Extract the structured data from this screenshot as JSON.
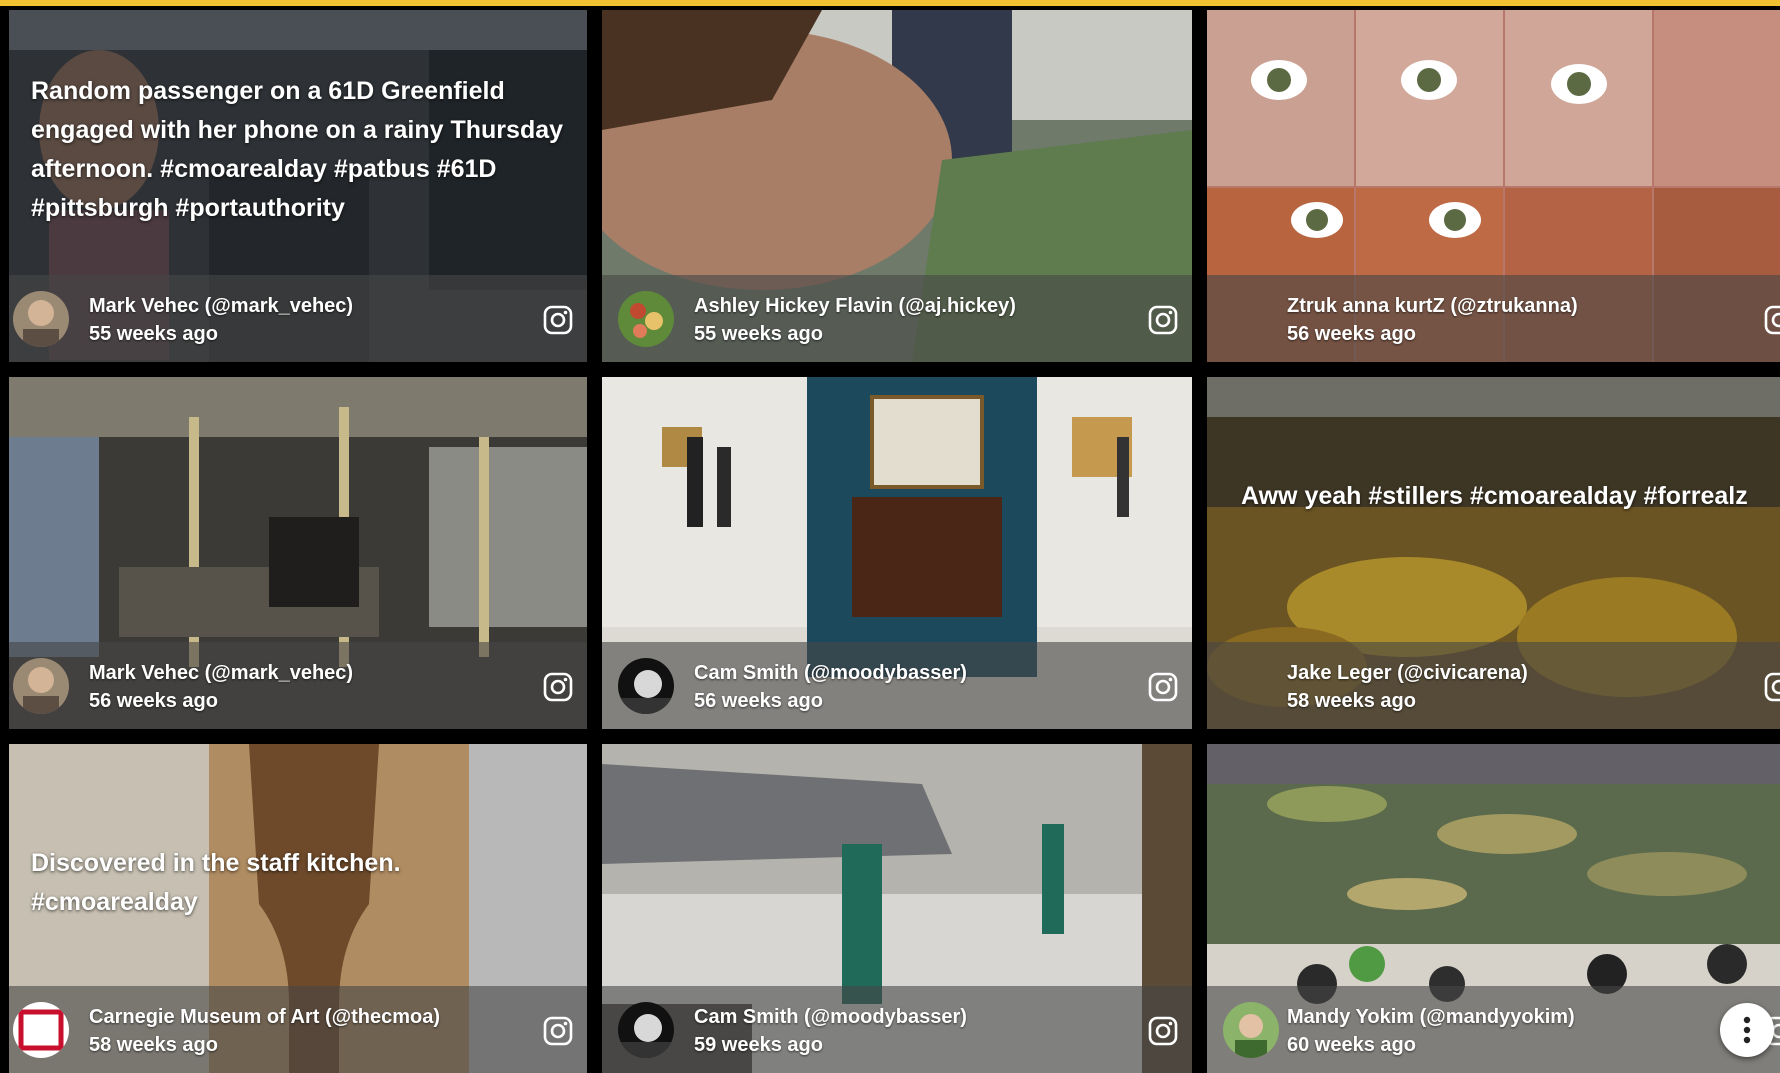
{
  "feed": {
    "tiles": [
      {
        "caption": "Random passenger on a 61D Greenfield engaged with her phone on a rainy Thursday afternoon. #cmoarealday #patbus #61D #pittsburgh #portauthority",
        "author": "Mark Vehec (@mark_vehec)",
        "time": "55 weeks ago",
        "source_icon": "instagram-icon"
      },
      {
        "caption": "",
        "author": "Ashley Hickey Flavin (@aj.hickey)",
        "time": "55 weeks ago",
        "source_icon": "instagram-icon"
      },
      {
        "caption": "",
        "author": "Ztruk anna kurtZ (@ztrukanna)",
        "time": "56 weeks ago",
        "source_icon": "instagram-icon"
      },
      {
        "caption": "",
        "author": "Mark Vehec (@mark_vehec)",
        "time": "56 weeks ago",
        "source_icon": "instagram-icon"
      },
      {
        "caption": "",
        "author": "Cam Smith (@moodybasser)",
        "time": "56 weeks ago",
        "source_icon": "instagram-icon"
      },
      {
        "caption": "Aww yeah #stillers #cmoarealday #forrealz",
        "author": "Jake Leger (@civicarena)",
        "time": "58 weeks ago",
        "source_icon": "instagram-icon"
      },
      {
        "caption": "Discovered in the staff kitchen. #cmoarealday",
        "author": "Carnegie Museum of Art (@thecmoa)",
        "time": "58 weeks ago",
        "source_icon": "instagram-icon"
      },
      {
        "caption": "",
        "author": "Cam Smith (@moodybasser)",
        "time": "59 weeks ago",
        "source_icon": "instagram-icon"
      },
      {
        "caption": "",
        "author": "Mandy Yokim (@mandyyokim)",
        "time": "60 weeks ago",
        "source_icon": "instagram-icon"
      }
    ]
  },
  "colors": {
    "accent_bar": "#f1c232",
    "background": "#000000",
    "meta_overlay": "rgba(70,70,70,0.6)"
  },
  "fab": {
    "icon": "more-vertical-icon"
  }
}
